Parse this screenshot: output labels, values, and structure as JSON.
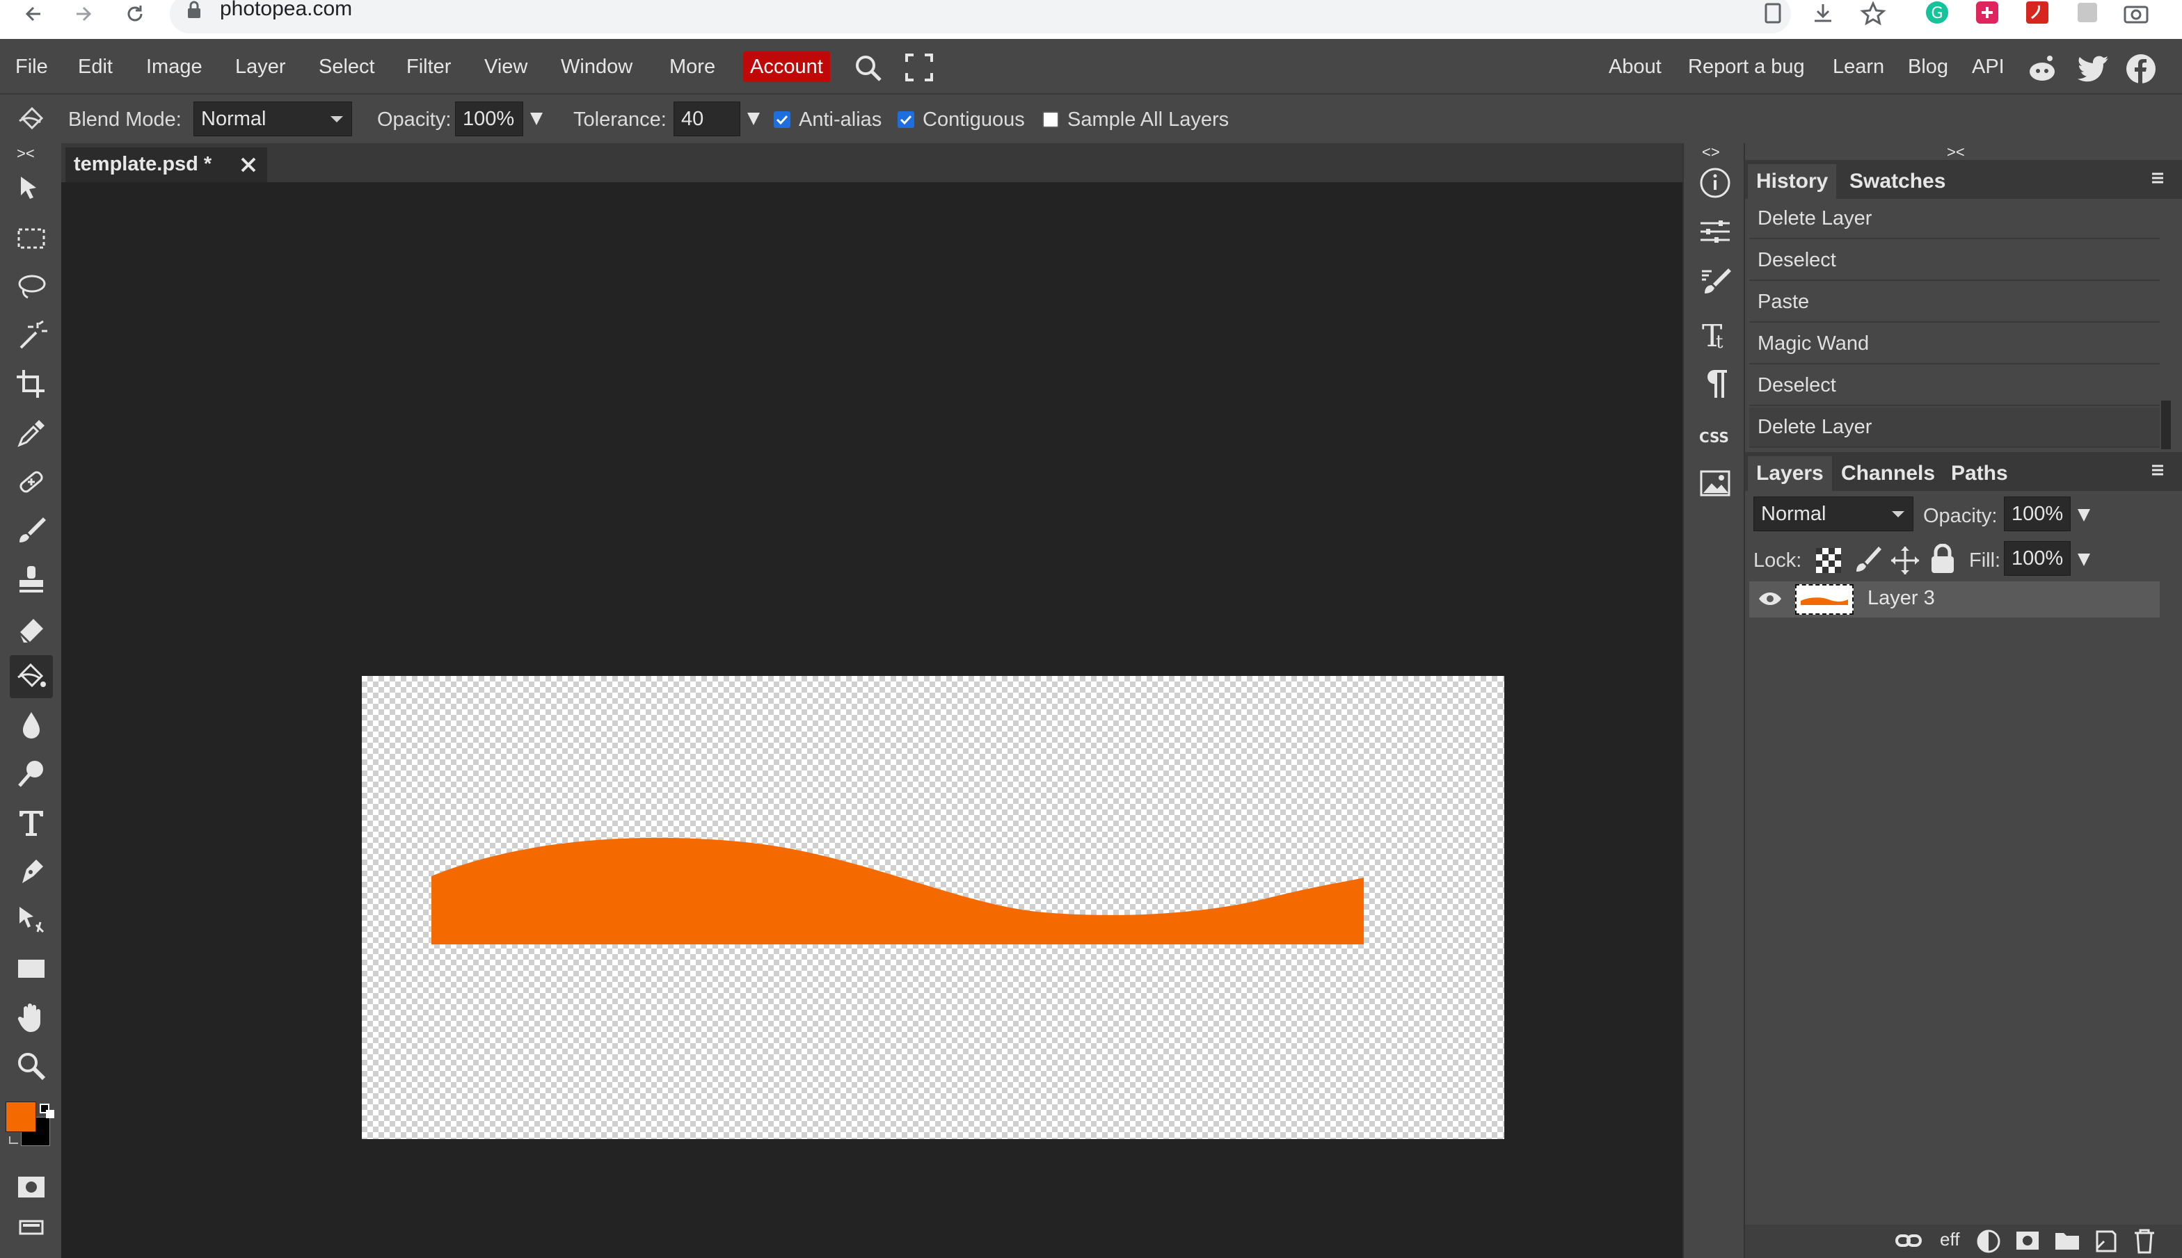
{
  "browser": {
    "url": "photopea.com"
  },
  "menubar": {
    "items": [
      "File",
      "Edit",
      "Image",
      "Layer",
      "Select",
      "Filter",
      "View",
      "Window",
      "More"
    ],
    "account": "Account",
    "right_links": [
      "About",
      "Report a bug",
      "Learn",
      "Blog",
      "API"
    ]
  },
  "options": {
    "blend_label": "Blend Mode:",
    "blend_value": "Normal",
    "opacity_label": "Opacity:",
    "opacity_value": "100%",
    "tolerance_label": "Tolerance:",
    "tolerance_value": "40",
    "anti_alias": "Anti-alias",
    "contiguous": "Contiguous",
    "sample_all": "Sample All Layers"
  },
  "document": {
    "tab_name": "template.psd *",
    "shape_color": "#f56a00"
  },
  "history": {
    "tabs": [
      "History",
      "Swatches"
    ],
    "items": [
      "Delete Layer",
      "Deselect",
      "Paste",
      "Magic Wand",
      "Deselect",
      "Delete Layer"
    ]
  },
  "layers": {
    "tabs": [
      "Layers",
      "Channels",
      "Paths"
    ],
    "blend": "Normal",
    "opacity_label": "Opacity:",
    "opacity_value": "100%",
    "lock_label": "Lock:",
    "fill_label": "Fill:",
    "fill_value": "100%",
    "items": [
      {
        "name": "Layer 3"
      }
    ],
    "footer_eff": "eff"
  },
  "colors": {
    "foreground": "#f56a00",
    "background": "#000000",
    "accent_account": "#c00808"
  }
}
